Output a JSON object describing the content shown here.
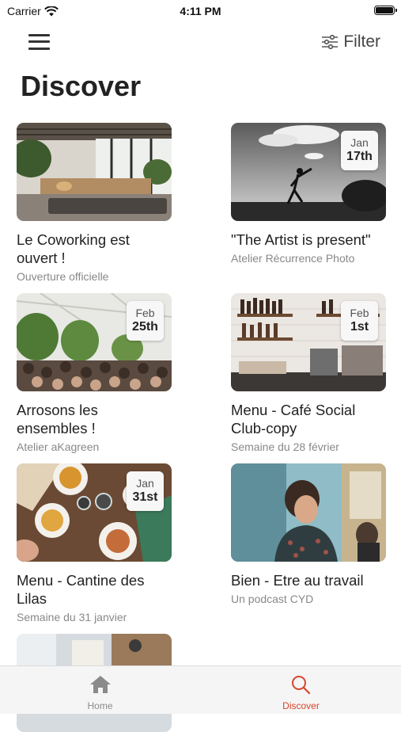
{
  "status": {
    "carrier": "Carrier",
    "time": "4:11 PM"
  },
  "header": {
    "filter_label": "Filter"
  },
  "page": {
    "title": "Discover"
  },
  "cards": [
    {
      "title": "Le Coworking est ouvert !",
      "subtitle": "Ouverture officielle"
    },
    {
      "title": "\"The Artist is present\"",
      "subtitle": "Atelier Récurrence Photo",
      "month": "Jan",
      "day": "17th"
    },
    {
      "title": "Arrosons les ensembles !",
      "subtitle": "Atelier aKagreen",
      "month": "Feb",
      "day": "25th"
    },
    {
      "title": "Menu - Café Social Club-copy",
      "subtitle": "Semaine du 28 février",
      "month": "Feb",
      "day": "1st"
    },
    {
      "title": "Menu - Cantine des Lilas",
      "subtitle": "Semaine du 31 janvier",
      "month": "Jan",
      "day": "31st"
    },
    {
      "title": "Bien - Etre au travail",
      "subtitle": "Un podcast CYD"
    }
  ],
  "tabs": [
    {
      "label": "Home",
      "icon": "house-icon",
      "color": "#8a8a8a"
    },
    {
      "label": "Discover",
      "icon": "search-icon",
      "color": "#d8452b"
    }
  ],
  "colors": {
    "accent": "#d8452b"
  }
}
